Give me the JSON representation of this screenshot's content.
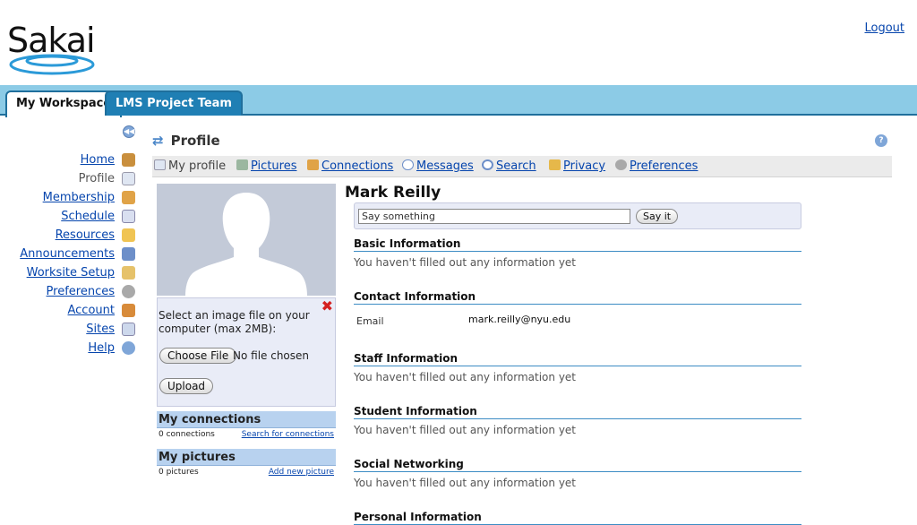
{
  "header": {
    "logo_text": "Sakai",
    "logout": "Logout"
  },
  "tabs": [
    {
      "label": "My Workspace"
    },
    {
      "label": "LMS Project Team"
    }
  ],
  "leftnav": [
    {
      "label": "Home"
    },
    {
      "label": "Profile"
    },
    {
      "label": "Membership"
    },
    {
      "label": "Schedule"
    },
    {
      "label": "Resources"
    },
    {
      "label": "Announcements"
    },
    {
      "label": "Worksite Setup"
    },
    {
      "label": "Preferences"
    },
    {
      "label": "Account"
    },
    {
      "label": "Sites"
    },
    {
      "label": "Help"
    }
  ],
  "tool": {
    "title": "Profile"
  },
  "toolnav": [
    {
      "label": "My profile"
    },
    {
      "label": "Pictures"
    },
    {
      "label": "Connections"
    },
    {
      "label": "Messages"
    },
    {
      "label": "Search"
    },
    {
      "label": "Privacy"
    },
    {
      "label": "Preferences"
    }
  ],
  "upload": {
    "prompt": "Select an image file on your computer (max 2MB):",
    "choose_label": "Choose File",
    "no_file": "No file chosen",
    "upload_label": "Upload"
  },
  "connections": {
    "title": "My connections",
    "count": "0 connections",
    "link": "Search for connections"
  },
  "pictures": {
    "title": "My pictures",
    "count": "0 pictures",
    "link": "Add new picture"
  },
  "profile": {
    "name": "Mark Reilly",
    "status_placeholder": "Say something",
    "say_label": "Say it",
    "basic": {
      "title": "Basic Information",
      "text": "You haven't filled out any information yet"
    },
    "contact": {
      "title": "Contact Information",
      "email_label": "Email",
      "email": "mark.reilly@nyu.edu"
    },
    "staff": {
      "title": "Staff Information",
      "text": "You haven't filled out any information yet"
    },
    "student": {
      "title": "Student Information",
      "text": "You haven't filled out any information yet"
    },
    "social": {
      "title": "Social Networking",
      "text": "You haven't filled out any information yet"
    },
    "personal": {
      "title": "Personal Information"
    }
  },
  "colors": {
    "tabbar": "#8ccbe6",
    "accent": "#1f6f9c",
    "link": "#0645ad"
  }
}
